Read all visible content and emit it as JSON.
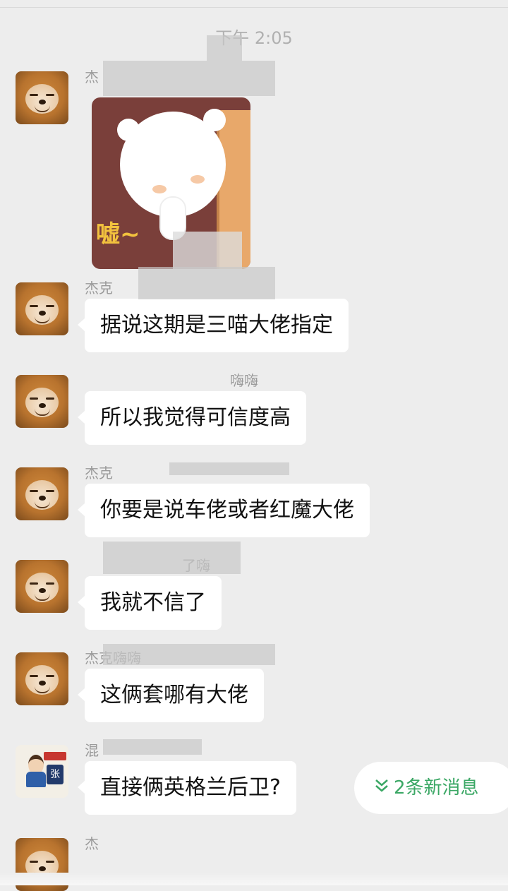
{
  "header": {
    "time": "下午 2:05"
  },
  "messages": [
    {
      "sender": "杰",
      "type": "sticker",
      "sticker_text": "嘘~",
      "avatar": "shiba-dog"
    },
    {
      "sender": "杰克",
      "type": "text",
      "text": "据说这期是三喵大佬指定",
      "avatar": "shiba-dog"
    },
    {
      "sender": "嗨嗨",
      "type": "text",
      "text": "所以我觉得可信度高",
      "avatar": "shiba-dog"
    },
    {
      "sender": "杰克",
      "type": "text",
      "text": "你要是说车佬或者红魔大佬",
      "avatar": "shiba-dog"
    },
    {
      "sender": "了嗨",
      "type": "text",
      "text": "我就不信了",
      "avatar": "shiba-dog"
    },
    {
      "sender": "杰克嗨嗨",
      "type": "text",
      "text": "这俩套哪有大佬",
      "avatar": "shiba-dog"
    },
    {
      "sender": "混",
      "type": "text",
      "text": "直接俩英格兰后卫?",
      "avatar": "kid-badge",
      "avatar_badge": "张"
    },
    {
      "sender": "杰",
      "type": "partial",
      "avatar": "shiba-dog"
    }
  ],
  "new_messages_pill": {
    "icon": "double-chevron-down-icon",
    "label": "2条新消息",
    "color": "#3aa764"
  }
}
